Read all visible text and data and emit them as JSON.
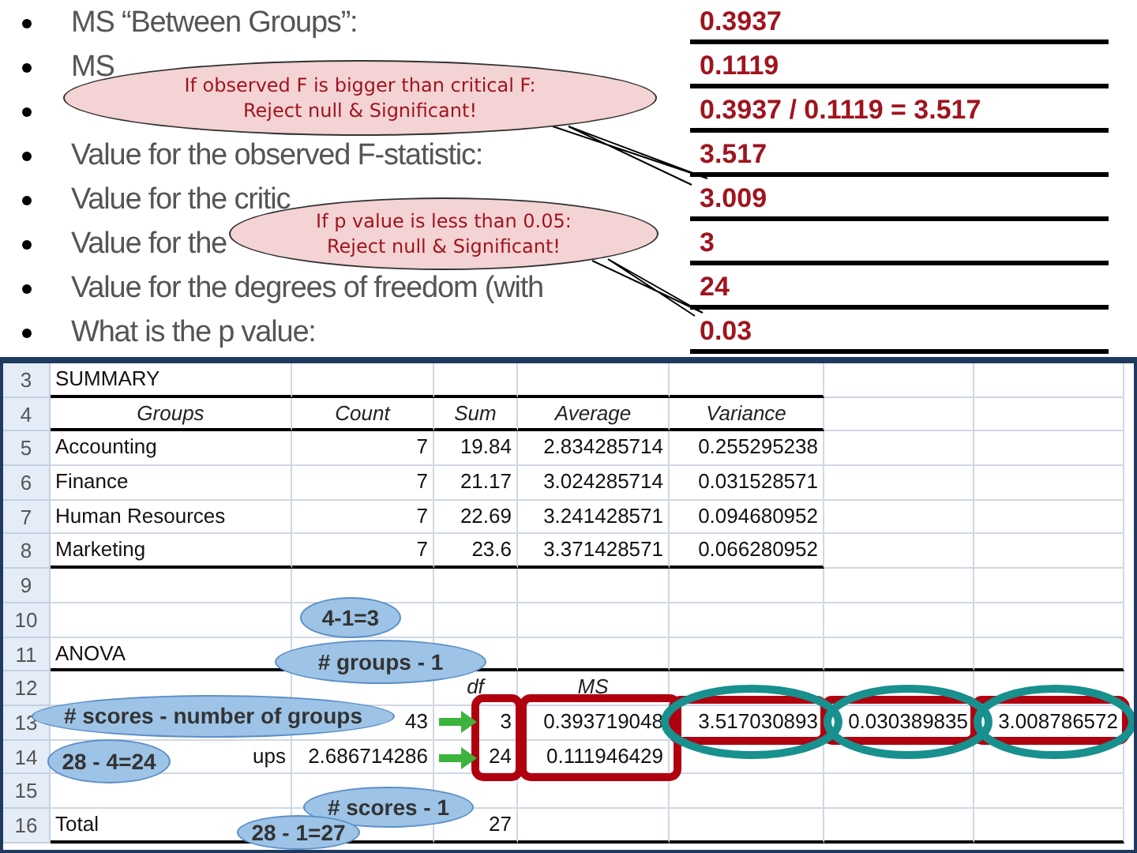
{
  "questions": [
    {
      "label": "MS “Between Groups”:",
      "answer": "0.3937"
    },
    {
      "label": "MS",
      "answer": "0.1119"
    },
    {
      "answer": "0.3937 / 0.1119 = 3.517"
    },
    {
      "label": "Value for the observed F-statistic:",
      "answer": "3.517"
    },
    {
      "label": "Value for the critic",
      "answer": "3.009"
    },
    {
      "label": "Value for the",
      "answer": "3"
    },
    {
      "label": "Value for the degrees of freedom (with",
      "answer": "24"
    },
    {
      "label": "What is the p value:",
      "answer": "0.03"
    }
  ],
  "notes": [
    {
      "text": "If observed F is bigger than critical F:\nReject null & Significant!"
    },
    {
      "text": "If p value is less than 0.05:\nReject null & Significant!"
    }
  ],
  "sheet": {
    "rows": [
      {
        "number": "3",
        "kind": "summary-title",
        "cells": {
          "a": "SUMMARY"
        }
      },
      {
        "number": "4",
        "kind": "summary-header",
        "cells": {
          "a": "Groups",
          "b": "Count",
          "c": "Sum",
          "d": "Average",
          "e": "Variance"
        }
      },
      {
        "number": "5",
        "kind": "summary-row",
        "cells": {
          "a": "Accounting",
          "b": "7",
          "c": "19.84",
          "d": "2.834285714",
          "e": "0.255295238"
        }
      },
      {
        "number": "6",
        "kind": "summary-row",
        "cells": {
          "a": "Finance",
          "b": "7",
          "c": "21.17",
          "d": "3.024285714",
          "e": "0.031528571"
        }
      },
      {
        "number": "7",
        "kind": "summary-row",
        "cells": {
          "a": "Human Resources",
          "b": "7",
          "c": "22.69",
          "d": "3.241428571",
          "e": "0.094680952"
        }
      },
      {
        "number": "8",
        "kind": "summary-last",
        "cells": {
          "a": "Marketing",
          "b": "7",
          "c": "23.6",
          "d": "3.371428571",
          "e": "0.066280952"
        }
      },
      {
        "number": "9",
        "kind": "blank",
        "cells": {}
      },
      {
        "number": "10",
        "kind": "blank",
        "cells": {}
      },
      {
        "number": "11",
        "kind": "anova-title",
        "cells": {
          "a": "ANOVA"
        }
      },
      {
        "number": "12",
        "kind": "anova-header",
        "cells": {
          "c": "df",
          "d": "MS"
        }
      },
      {
        "number": "13",
        "kind": "anova-row",
        "cells": {
          "b": "43",
          "c": "3",
          "d": "0.393719048",
          "e": "3.517030893",
          "f": "0.030389835",
          "g": "3.008786572"
        }
      },
      {
        "number": "14",
        "kind": "anova-row",
        "cells": {
          "a": "ups",
          "b": "2.686714286",
          "c": "24",
          "d": "0.111946429"
        }
      },
      {
        "number": "15",
        "kind": "blank",
        "cells": {}
      },
      {
        "number": "16",
        "kind": "total",
        "cells": {
          "a": "Total",
          "c": "27"
        }
      }
    ]
  },
  "callouts": [
    {
      "text": "4-1=3"
    },
    {
      "text": "# groups - 1"
    },
    {
      "text": "# scores - number of groups"
    },
    {
      "text": "28 - 4=24"
    },
    {
      "text": "# scores - 1"
    },
    {
      "text": "28 - 1=27"
    }
  ]
}
